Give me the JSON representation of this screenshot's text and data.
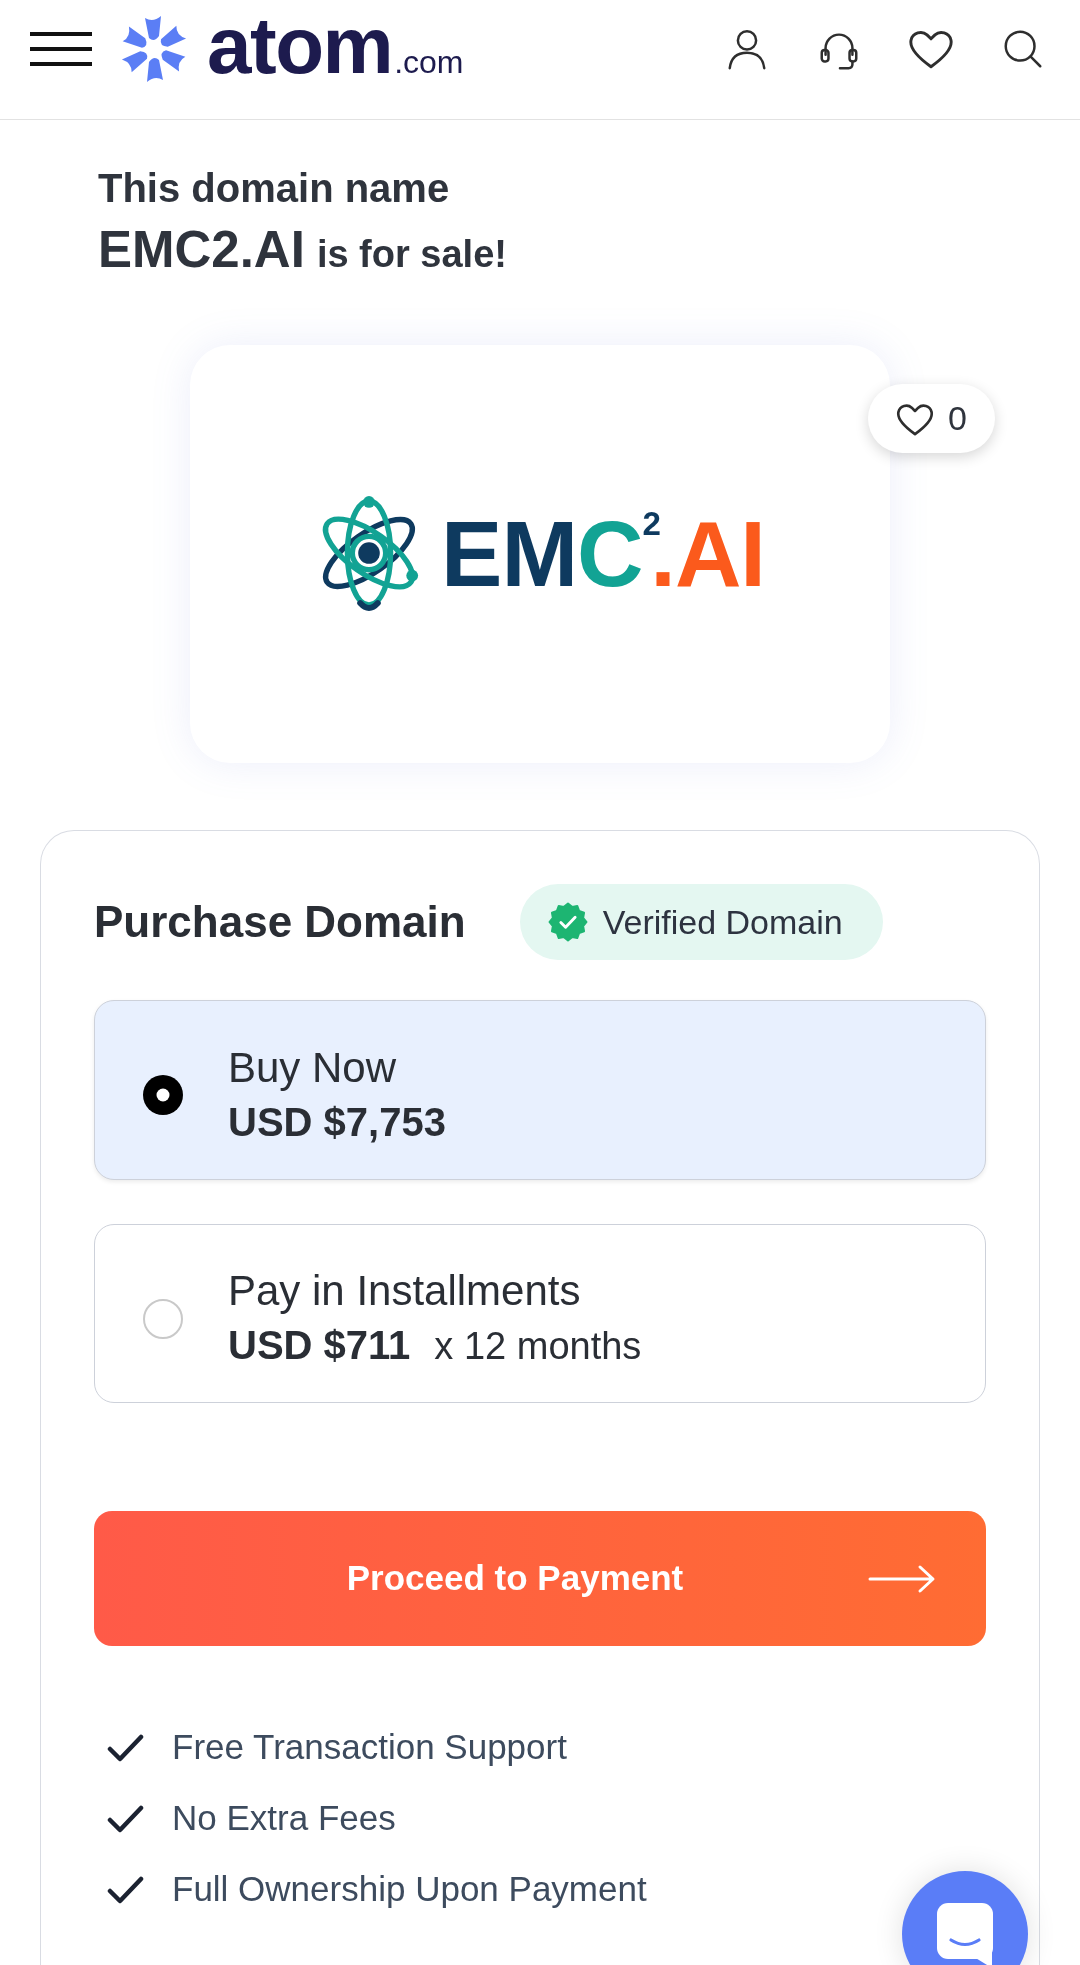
{
  "header": {
    "brand": {
      "name": "atom",
      "suffix": ".com"
    }
  },
  "heading": {
    "intro": "This domain name",
    "domain": "EMC2.AI",
    "tail": "is for sale!"
  },
  "logo_card": {
    "wordmark": [
      {
        "text": "EM",
        "color": "#0e3a5f",
        "kind": "plain"
      },
      {
        "text": "C",
        "color": "#12a394",
        "kind": "plain"
      },
      {
        "text": "2",
        "color": "#0e3a5f",
        "kind": "superscript"
      },
      {
        "text": ".AI",
        "color": "#fb5a1c",
        "kind": "plain"
      }
    ],
    "favorites": "0"
  },
  "purchase": {
    "title": "Purchase Domain",
    "badge": "Verified Domain",
    "options": [
      {
        "label": "Buy Now",
        "price": "USD $7,753",
        "selected": true
      },
      {
        "label": "Pay in Installments",
        "price": "USD $711",
        "term": "x 12 months",
        "selected": false
      }
    ],
    "button": "Proceed to Payment",
    "features": [
      "Free Transaction Support",
      "No Extra Fees",
      "Full Ownership Upon Payment"
    ]
  }
}
